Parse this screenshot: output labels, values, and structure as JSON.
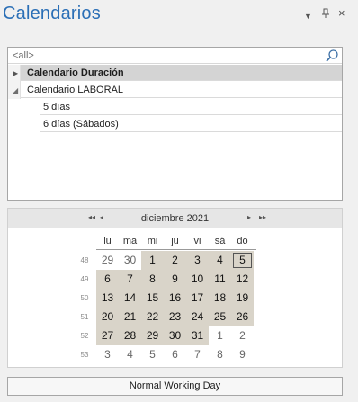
{
  "header": {
    "title": "Calendarios",
    "menu_icon": "▼",
    "pin_icon": "ᵖ",
    "close_icon": "×"
  },
  "tree": {
    "filter_text": "<all>",
    "items": [
      {
        "label": "Calendario Duración",
        "expander": "▶"
      },
      {
        "label": "Calendario LABORAL",
        "expander": "◢"
      },
      {
        "label": "5 días"
      },
      {
        "label": "6 días (Sábados)"
      }
    ]
  },
  "calendar": {
    "month_label": "diciembre 2021",
    "nav": {
      "prev_year": "◂◂",
      "prev_month": "◂",
      "next_month": "▸",
      "next_year": "▸▸"
    },
    "weekdays": [
      "lu",
      "ma",
      "mi",
      "ju",
      "vi",
      "sá",
      "do"
    ],
    "weeks": [
      {
        "num": "48",
        "days": [
          "29",
          "30",
          "1",
          "2",
          "3",
          "4",
          "5"
        ]
      },
      {
        "num": "49",
        "days": [
          "6",
          "7",
          "8",
          "9",
          "10",
          "11",
          "12"
        ]
      },
      {
        "num": "50",
        "days": [
          "13",
          "14",
          "15",
          "16",
          "17",
          "18",
          "19"
        ]
      },
      {
        "num": "51",
        "days": [
          "20",
          "21",
          "22",
          "23",
          "24",
          "25",
          "26"
        ]
      },
      {
        "num": "52",
        "days": [
          "27",
          "28",
          "29",
          "30",
          "31",
          "1",
          "2"
        ]
      },
      {
        "num": "53",
        "days": [
          "3",
          "4",
          "5",
          "6",
          "7",
          "8",
          "9"
        ]
      }
    ],
    "selected_day": "5"
  },
  "status": {
    "text": "Normal Working Day"
  },
  "colors": {
    "title": "#2b6fb6",
    "month_day_fill": "#d9d4c9",
    "selected_row": "#d4d4d4"
  }
}
